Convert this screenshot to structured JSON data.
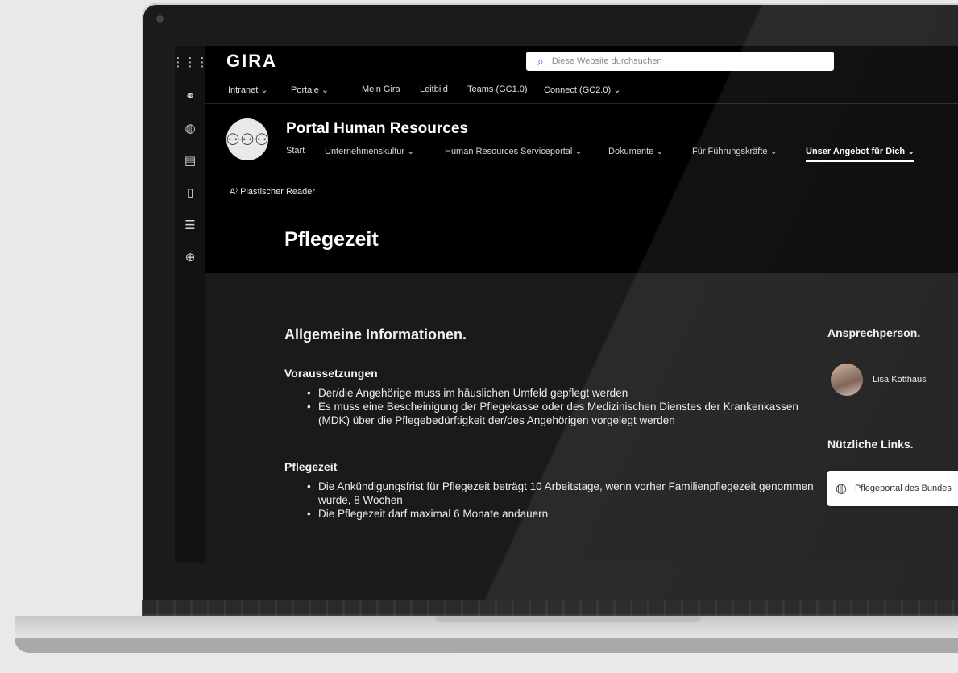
{
  "topbar": {
    "logo": "GIRA",
    "search_placeholder": "Diese Website durchsuchen"
  },
  "hubnav": {
    "items": [
      {
        "label": "Intranet",
        "dropdown": true
      },
      {
        "label": "Portale",
        "dropdown": true
      },
      {
        "label": "Mein Gira",
        "dropdown": false
      },
      {
        "label": "Leitbild",
        "dropdown": false
      },
      {
        "label": "Teams (GC1.0)",
        "dropdown": false
      },
      {
        "label": "Connect (GC2.0)",
        "dropdown": true
      }
    ]
  },
  "site": {
    "title": "Portal Human Resources",
    "nav": [
      {
        "label": "Start",
        "dropdown": false
      },
      {
        "label": "Unternehmenskultur",
        "dropdown": true
      },
      {
        "label": "Human Resources Serviceportal",
        "dropdown": true
      },
      {
        "label": "Dokumente",
        "dropdown": true
      },
      {
        "label": "Für Führungskräfte",
        "dropdown": true
      },
      {
        "label": "Unser Angebot für Dich",
        "dropdown": true,
        "active": true
      }
    ]
  },
  "commandbar": {
    "reader_label": "Plastischer Reader"
  },
  "page": {
    "title": "Pflegezeit"
  },
  "main": {
    "section_title": "Allgemeine Informationen.",
    "voraussetzungen": {
      "heading": "Voraussetzungen",
      "items": [
        "Der/die Angehörige muss im häuslichen Umfeld gepflegt werden",
        "Es muss eine Bescheinigung der Pflegekasse oder des Medizinischen Dienstes der Krankenkassen (MDK) über die Pflegebedürftigkeit der/des Angehörigen vorgelegt werden"
      ]
    },
    "pflegezeit": {
      "heading": "Pflegezeit",
      "items": [
        "Die Ankündigungsfrist für Pflegezeit beträgt 10 Arbeitstage, wenn vorher Familienpflegezeit genommen wurde, 8 Wochen",
        "Die Pflegezeit darf maximal 6 Monate andauern"
      ]
    }
  },
  "aside": {
    "contact_title": "Ansprechperson.",
    "contact_name": "Lisa Kotthaus",
    "links_title": "Nützliche Links.",
    "link_label": "Pflegeportal des Bundes"
  },
  "icons": {
    "app_launcher": "waffle-icon",
    "rail": [
      "share-icon",
      "globe-icon",
      "news-icon",
      "document-icon",
      "list-icon",
      "add-circle-icon"
    ]
  }
}
